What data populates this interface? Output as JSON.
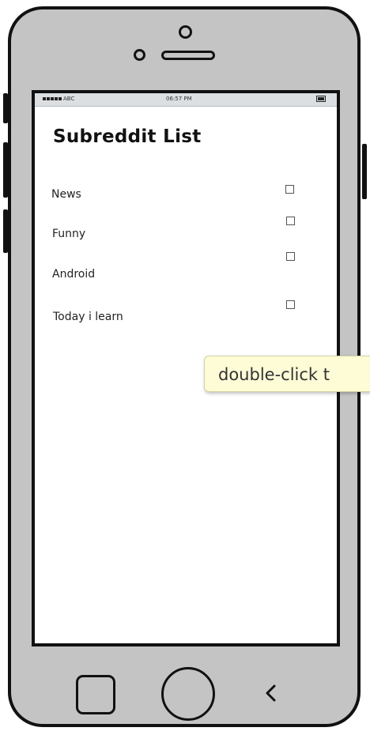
{
  "status_bar": {
    "carrier": "ABC",
    "time": "06:57 PM"
  },
  "screen": {
    "title": "Subreddit List",
    "items": [
      {
        "label": "News",
        "checked": false
      },
      {
        "label": "Funny",
        "checked": false
      },
      {
        "label": "Android",
        "checked": false
      },
      {
        "label": "Today i learn",
        "checked": false
      }
    ]
  },
  "tooltip": {
    "text": "double-click t"
  },
  "icons": {
    "nav_square": "square-icon",
    "nav_home": "home-circle-icon",
    "nav_back": "back-chevron-icon"
  },
  "colors": {
    "phone_body": "#c4c4c4",
    "tooltip_bg": "#fefcd6",
    "status_bar": "#dcdfe1"
  }
}
